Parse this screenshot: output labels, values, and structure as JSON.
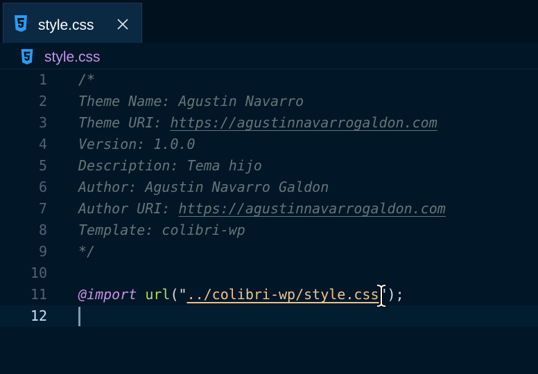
{
  "tab": {
    "label": "style.css",
    "icon": "css-file-icon",
    "close_icon": "close-icon"
  },
  "breadcrumb": {
    "label": "style.css",
    "icon": "css-file-icon"
  },
  "colors": {
    "background": "#011627",
    "comment": "#637777",
    "at_rule": "#c792ea",
    "function": "#addb67",
    "string": "#ecc48d",
    "css_icon": "#2b9bf4"
  },
  "editor": {
    "lines": [
      {
        "number": "1",
        "text": "/*"
      },
      {
        "number": "2",
        "text": "Theme Name: Agustin Navarro"
      },
      {
        "number": "3",
        "prefix": "Theme URI: ",
        "link": "https://agustinnavarrogaldon.com"
      },
      {
        "number": "4",
        "text": "Version: 1.0.0"
      },
      {
        "number": "5",
        "text": "Description: Tema hijo"
      },
      {
        "number": "6",
        "text": "Author: Agustin Navarro Galdon"
      },
      {
        "number": "7",
        "prefix": "Author URI: ",
        "link": "https://agustinnavarrogaldon.com"
      },
      {
        "number": "8",
        "text": "Template: colibri-wp"
      },
      {
        "number": "9",
        "text": "*/"
      },
      {
        "number": "10",
        "text": ""
      },
      {
        "number": "11",
        "at_rule": "@import",
        "space": " ",
        "function": "url",
        "open": "(\"",
        "string": "../colibri-wp/style.css",
        "close": "\");"
      },
      {
        "number": "12",
        "text": ""
      }
    ],
    "current_line": "12"
  }
}
